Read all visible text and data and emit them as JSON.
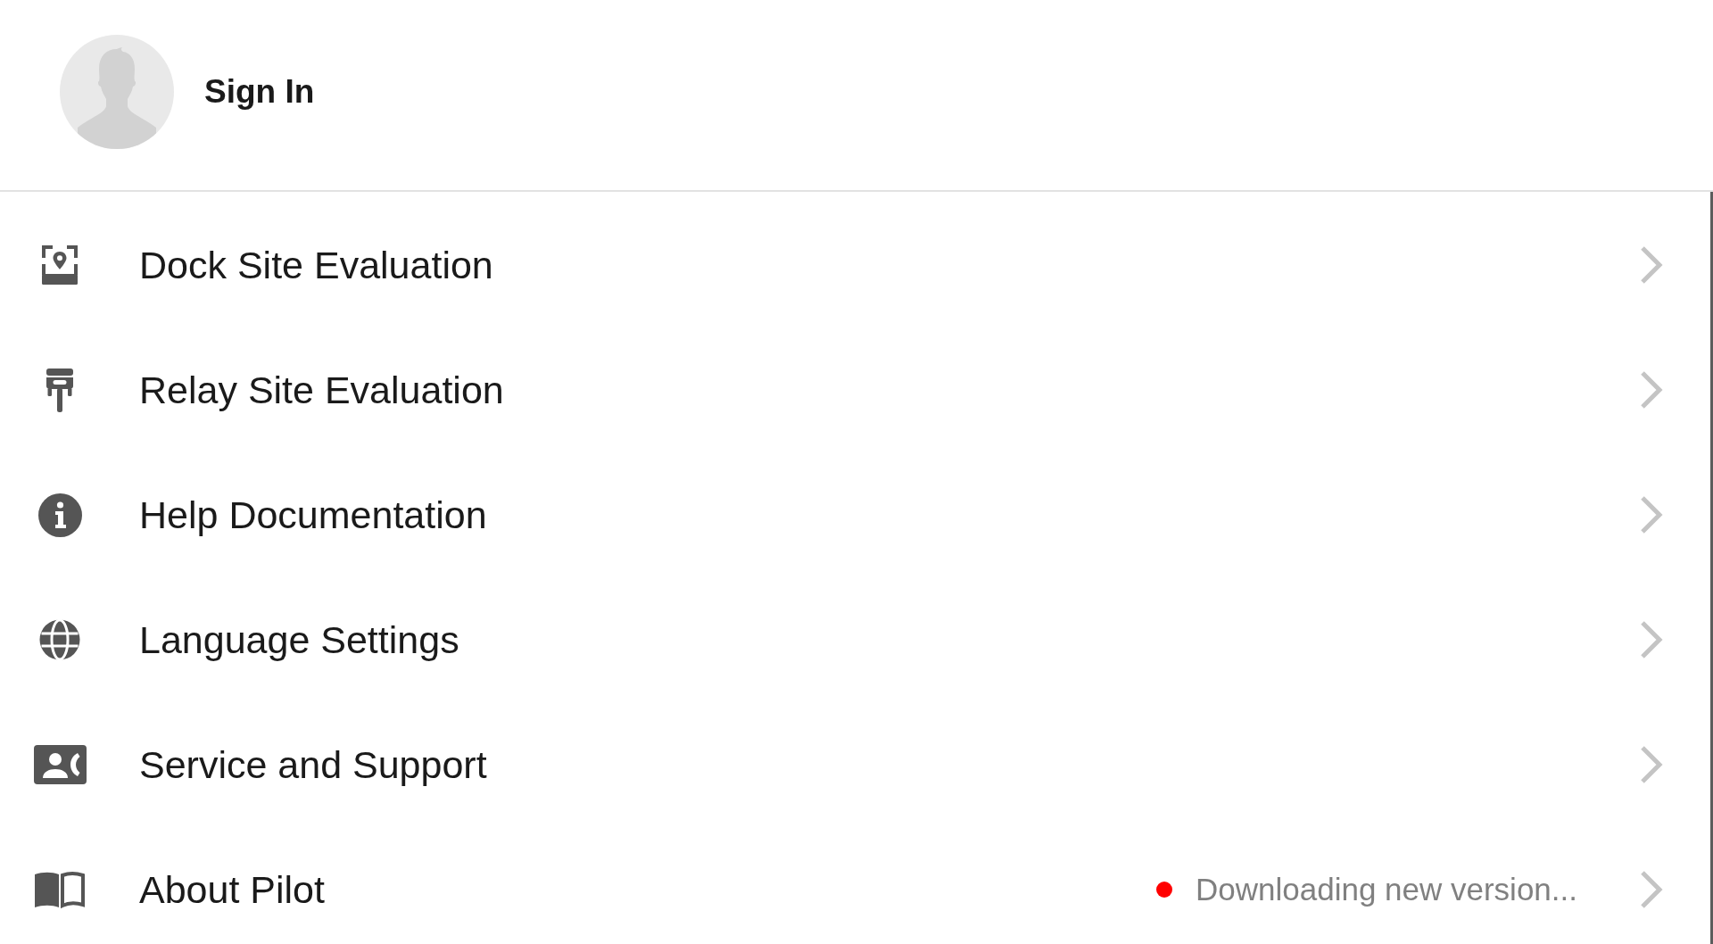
{
  "header": {
    "title": "Sign In"
  },
  "menu_items": [
    {
      "kind": "dock",
      "label": "Dock Site Evaluation"
    },
    {
      "kind": "relay",
      "label": "Relay Site Evaluation"
    },
    {
      "kind": "info",
      "label": "Help Documentation"
    },
    {
      "kind": "globe",
      "label": "Language Settings"
    },
    {
      "kind": "support",
      "label": "Service and Support"
    },
    {
      "kind": "book",
      "label": "About Pilot",
      "status": {
        "text": "Downloading new version...",
        "color": "#ff0000"
      }
    }
  ]
}
